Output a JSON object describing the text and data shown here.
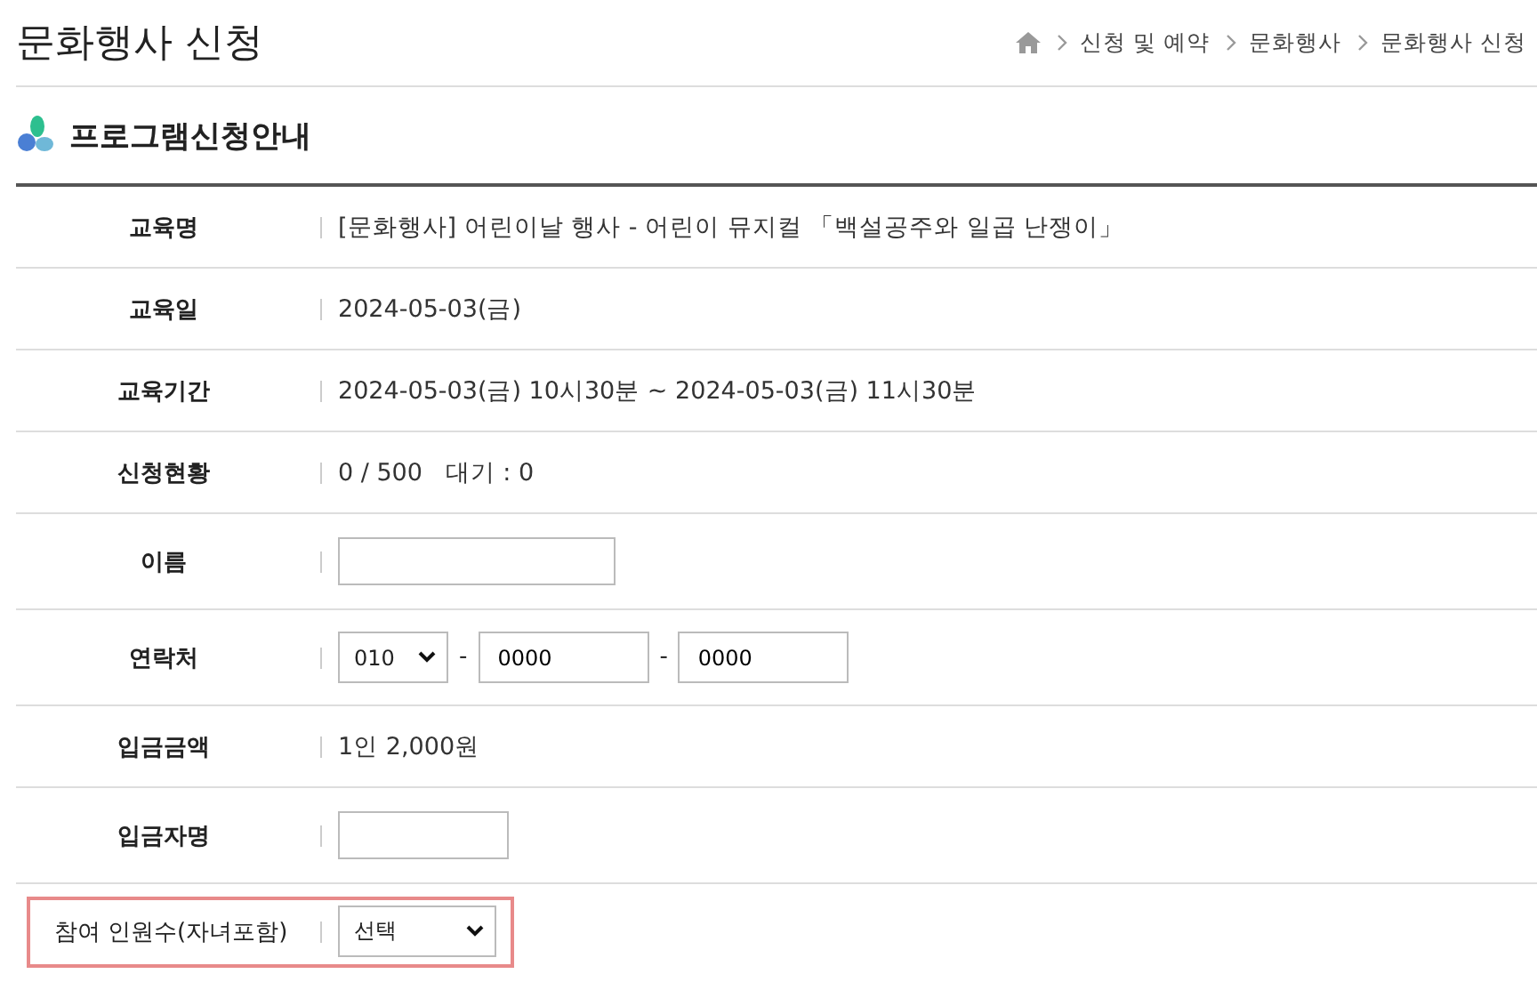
{
  "page_title": "문화행사 신청",
  "breadcrumb": [
    "신청 및 예약",
    "문화행사",
    "문화행사 신청"
  ],
  "section_title": "프로그램신청안내",
  "rows": [
    {
      "kind": "text",
      "label": "교육명",
      "value": "[문화행사] 어린이날 행사 - 어린이 뮤지컬 「백설공주와 일곱 난쟁이」"
    },
    {
      "kind": "text",
      "label": "교육일",
      "value": "2024-05-03(금)"
    },
    {
      "kind": "text",
      "label": "교육기간",
      "value": "2024-05-03(금) 10시30분 ~ 2024-05-03(금) 11시30분"
    },
    {
      "kind": "text",
      "label": "신청현황",
      "value": "0 / 500   대기 : 0"
    },
    {
      "kind": "longinput",
      "label": "이름"
    },
    {
      "kind": "phone",
      "label": "연락처",
      "prefix": "010",
      "separator": "-",
      "middle": "0000",
      "last": "0000"
    },
    {
      "kind": "text",
      "label": "입금금액",
      "value": "1인 2,000원"
    },
    {
      "kind": "input",
      "label": "입금자명"
    },
    {
      "kind": "select",
      "label": "참여 인원수(자녀포함)",
      "value": "선택",
      "highlighted": true
    }
  ]
}
